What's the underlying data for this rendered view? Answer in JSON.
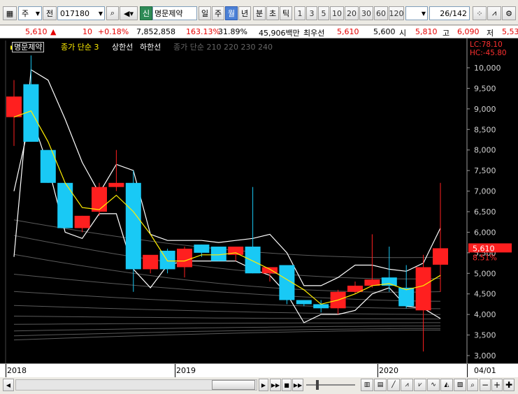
{
  "toolbar": {
    "market_type": "주",
    "period_prefix": "전",
    "code": "017180",
    "credit_badge": "신",
    "name": "명문제약",
    "period_buttons": [
      "일",
      "주",
      "월",
      "년",
      "분",
      "초",
      "틱"
    ],
    "active_period": "월",
    "numbers": [
      "1",
      "3",
      "5",
      "10",
      "20",
      "30",
      "60",
      "120"
    ],
    "page_count": "26",
    "page_total": "/142"
  },
  "info": {
    "price": "5,610",
    "change_arrow": "▲",
    "change": "10",
    "change_pct": "+0.18%",
    "volume": "7,852,858",
    "vol_ratio": "163.13%",
    "turnover": "31.89%",
    "amount": "45,906백만",
    "best_label": "최우선",
    "best_ask": "5,610",
    "best_bid": "5,600",
    "open_label": "시",
    "open": "5,810",
    "high_label": "고",
    "high": "6,090",
    "low_label": "저",
    "low": "5,53"
  },
  "legend": {
    "name": "명문제약",
    "ma_label": "종가 단순 3",
    "upper_label": "상한선",
    "lower_label": "하한선",
    "ma_multi_label": "종가 단순 210 220 230 240"
  },
  "axis_info": {
    "lc": "LC:78.10",
    "hc": "HC:-45.80",
    "current_price": "5,610",
    "current_pct": "8.51%"
  },
  "y_ticks": [
    "10,000",
    "9,500",
    "9,000",
    "8,500",
    "8,000",
    "7,500",
    "7,000",
    "6,500",
    "6,000",
    "5,500",
    "5,000",
    "4,500",
    "4,000",
    "3,500",
    "3,000"
  ],
  "x_labels": [
    "2018",
    "2019",
    "2020",
    "04/01"
  ],
  "colors": {
    "up": "#ff1f1f",
    "down": "#19c9f5",
    "ma3": "#ffee00",
    "band": "#ffffff",
    "longma": "#5a5a5a"
  },
  "chart_data": {
    "type": "candlestick",
    "ylim": [
      2900,
      10300
    ],
    "candles": [
      {
        "o": 8800,
        "h": 9700,
        "l": 8100,
        "c": 9300
      },
      {
        "o": 9600,
        "h": 10300,
        "l": 8200,
        "c": 8200
      },
      {
        "o": 8000,
        "h": 8000,
        "l": 7200,
        "c": 7200
      },
      {
        "o": 7200,
        "h": 7200,
        "l": 6100,
        "c": 6100
      },
      {
        "o": 6100,
        "h": 6400,
        "l": 6000,
        "c": 6400
      },
      {
        "o": 6500,
        "h": 7200,
        "l": 6400,
        "c": 7100
      },
      {
        "o": 7100,
        "h": 8000,
        "l": 7000,
        "c": 7200
      },
      {
        "o": 7200,
        "h": 7500,
        "l": 4550,
        "c": 5100
      },
      {
        "o": 5100,
        "h": 5300,
        "l": 5000,
        "c": 5450
      },
      {
        "o": 5550,
        "h": 5600,
        "l": 5000,
        "c": 5100
      },
      {
        "o": 5150,
        "h": 5650,
        "l": 4900,
        "c": 5600
      },
      {
        "o": 5700,
        "h": 5700,
        "l": 5400,
        "c": 5500
      },
      {
        "o": 5650,
        "h": 5650,
        "l": 5300,
        "c": 5300
      },
      {
        "o": 5450,
        "h": 5650,
        "l": 5300,
        "c": 5650
      },
      {
        "o": 5650,
        "h": 7100,
        "l": 5000,
        "c": 5000
      },
      {
        "o": 5000,
        "h": 5100,
        "l": 4800,
        "c": 5150
      },
      {
        "o": 5200,
        "h": 5200,
        "l": 4250,
        "c": 4350
      },
      {
        "o": 4350,
        "h": 4350,
        "l": 4200,
        "c": 4250
      },
      {
        "o": 4250,
        "h": 4350,
        "l": 4050,
        "c": 4150
      },
      {
        "o": 4150,
        "h": 4600,
        "l": 4000,
        "c": 4550
      },
      {
        "o": 4550,
        "h": 4800,
        "l": 4500,
        "c": 4700
      },
      {
        "o": 4700,
        "h": 5950,
        "l": 4650,
        "c": 4850
      },
      {
        "o": 4900,
        "h": 5650,
        "l": 4550,
        "c": 4700
      },
      {
        "o": 4650,
        "h": 5200,
        "l": 4150,
        "c": 4200
      },
      {
        "o": 4100,
        "h": 5450,
        "l": 3100,
        "c": 5150
      },
      {
        "o": 5210,
        "h": 7200,
        "l": 4550,
        "c": 5610
      }
    ],
    "ma3": [
      8800,
      8950,
      8200,
      7200,
      6600,
      6550,
      6900,
      6500,
      5950,
      5300,
      5300,
      5450,
      5450,
      5500,
      5300,
      5100,
      4850,
      4600,
      4250,
      4350,
      4500,
      4700,
      4750,
      4600,
      4700,
      4950
    ],
    "upper_band": [
      5400,
      9950,
      9700,
      8750,
      7700,
      6950,
      7650,
      7500,
      5950,
      5800,
      5800,
      5800,
      5750,
      5800,
      5850,
      5950,
      5500,
      4700,
      4700,
      4900,
      5200,
      5200,
      5100,
      5050,
      5250,
      6100
    ],
    "lower_band": [
      7000,
      8850,
      7600,
      6000,
      5850,
      6450,
      6450,
      5100,
      4650,
      5200,
      5300,
      5300,
      5300,
      5300,
      5100,
      4950,
      4500,
      3800,
      4000,
      4000,
      4100,
      4500,
      4650,
      4200,
      4150,
      3900
    ]
  }
}
